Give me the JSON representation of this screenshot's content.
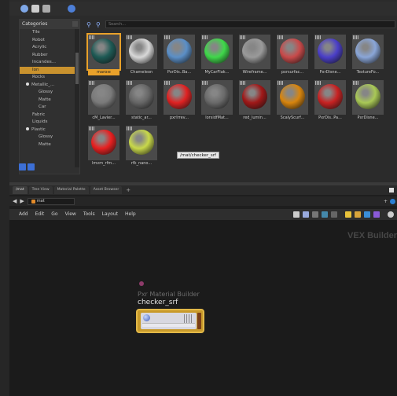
{
  "palette": {
    "categories_title": "Categories",
    "categories": [
      {
        "label": "Tile",
        "indent": 2,
        "bullet": false
      },
      {
        "label": "Robot",
        "indent": 2,
        "bullet": false
      },
      {
        "label": "Acrylic",
        "indent": 2,
        "bullet": false
      },
      {
        "label": "Rubber",
        "indent": 2,
        "bullet": false
      },
      {
        "label": "Incandes...",
        "indent": 2,
        "bullet": false
      },
      {
        "label": "Ion",
        "indent": 2,
        "bullet": false,
        "selected": true
      },
      {
        "label": "Rocks",
        "indent": 2,
        "bullet": false
      },
      {
        "label": "Metallic_...",
        "indent": 1,
        "bullet": true
      },
      {
        "label": "Glossy",
        "indent": 3,
        "bullet": false
      },
      {
        "label": "Matte",
        "indent": 3,
        "bullet": false
      },
      {
        "label": "Car",
        "indent": 3,
        "bullet": false
      },
      {
        "label": "Fabric",
        "indent": 2,
        "bullet": false
      },
      {
        "label": "Liquids",
        "indent": 2,
        "bullet": false
      },
      {
        "label": "Plastic",
        "indent": 1,
        "bullet": true
      },
      {
        "label": "Glossy",
        "indent": 3,
        "bullet": false
      },
      {
        "label": "Matte",
        "indent": 3,
        "bullet": false
      }
    ],
    "search_placeholder": "Search...",
    "materials": [
      {
        "label": "marble",
        "color": "#1e5a55",
        "selected": true
      },
      {
        "label": "Chameleon",
        "color": "#d8d8d8"
      },
      {
        "label": "PxrDis..Ba...",
        "color": "#5b8fc7"
      },
      {
        "label": "MyCarFlak...",
        "color": "#3fd84a"
      },
      {
        "label": "Wireframe...",
        "color": "#9a9a9a"
      },
      {
        "label": "pxrsurfac...",
        "color": "#c84a4a"
      },
      {
        "label": "PxrDisne...",
        "color": "#4b3fc8"
      },
      {
        "label": "TextureFo...",
        "color": "#8aa6d8"
      },
      {
        "label": "cM_Lavier...",
        "color": "#7a7a7a"
      },
      {
        "label": "static_ar...",
        "color": "#666666"
      },
      {
        "label": "pxrIrrev...",
        "color": "#e02222"
      },
      {
        "label": "lorsidfMat...",
        "color": "#6a6a6a"
      },
      {
        "label": "red_lumin...",
        "color": "#a01818"
      },
      {
        "label": "ScalyScurf...",
        "color": "#d8850e"
      },
      {
        "label": "PxrDis..Pa...",
        "color": "#c82222"
      },
      {
        "label": "PxrDisne...",
        "color": "#a9c856"
      },
      {
        "label": "lmvm_rfm...",
        "color": "#e82020"
      },
      {
        "label": "rfk_nano...",
        "color": "#c8d84a"
      }
    ],
    "tooltip": "/mat/checker_srf"
  },
  "network": {
    "tabs": [
      {
        "label": "/mat",
        "active": true
      },
      {
        "label": "Tree View"
      },
      {
        "label": "Material Palette"
      },
      {
        "label": "Asset Browser"
      }
    ],
    "path": "mat",
    "menus": [
      "Add",
      "Edit",
      "Go",
      "View",
      "Tools",
      "Layout",
      "Help"
    ],
    "context_label": "VEX Builder",
    "node_type": "Pxr Material Builder",
    "node_name": "checker_srf"
  },
  "colors": {
    "selection": "#e9a12a",
    "node_fill": "#c89a2b",
    "accent_blue": "#3c6fd6"
  }
}
